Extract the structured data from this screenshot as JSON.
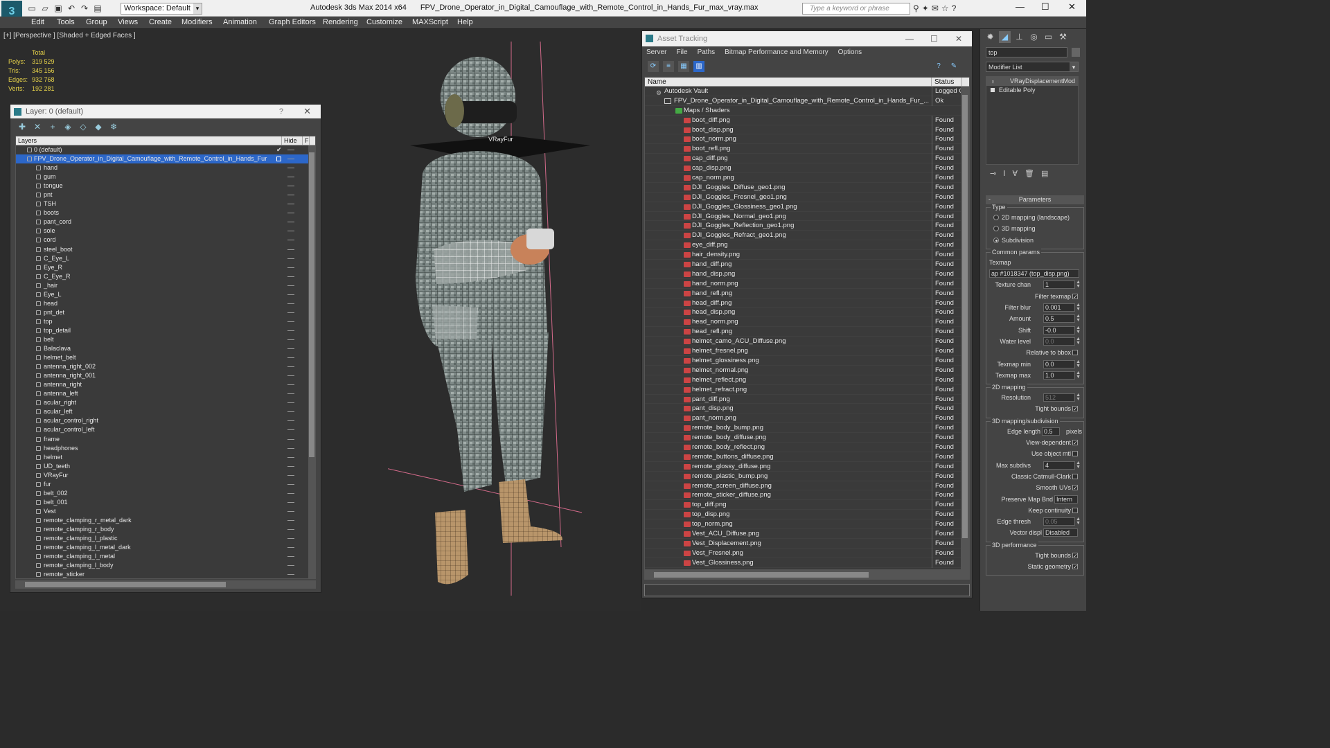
{
  "app": {
    "title": "Autodesk 3ds Max 2014 x64",
    "file": "FPV_Drone_Operator_in_Digital_Camouflage_with_Remote_Control_in_Hands_Fur_max_vray.max",
    "workspace": "Workspace: Default",
    "search_placeholder": "Type a keyword or phrase"
  },
  "menu": [
    "Edit",
    "Tools",
    "Group",
    "Views",
    "Create",
    "Modifiers",
    "Animation",
    "Graph Editors",
    "Rendering",
    "Customize",
    "MAXScript",
    "Help"
  ],
  "viewport": {
    "label": "[+] [Perspective ] [Shaded + Edged Faces ]",
    "stats_header": "Total",
    "stats": [
      {
        "label": "Polys:",
        "value": "319 529"
      },
      {
        "label": "Tris:",
        "value": "345 156"
      },
      {
        "label": "Edges:",
        "value": "932 768"
      },
      {
        "label": "Verts:",
        "value": "192 281"
      }
    ],
    "fur_label": "VRayFur"
  },
  "layer_window": {
    "title": "Layer: 0 (default)",
    "help": "?",
    "col_layers": "Layers",
    "col_hide": "Hide",
    "col_extra": "F",
    "default_layer": "0 (default)",
    "selected_layer": "FPV_Drone_Operator_in_Digital_Camouflage_with_Remote_Control_in_Hands_Fur",
    "items": [
      "hand",
      "gum",
      "tongue",
      "pnt",
      "TSH",
      "boots",
      "pant_cord",
      "sole",
      "cord",
      "steel_boot",
      "C_Eye_L",
      "Eye_R",
      "C_Eye_R",
      "_hair",
      "Eye_L",
      "head",
      "pnt_det",
      "top",
      "top_detail",
      "belt",
      "Balaclava",
      "helmet_belt",
      "antenna_right_002",
      "antenna_right_001",
      "antenna_right",
      "antenna_left",
      "acular_right",
      "acular_left",
      "acular_control_right",
      "acular_control_left",
      "frame",
      "headphones",
      "helmet",
      "UD_teeth",
      "VRayFur",
      "fur",
      "belt_002",
      "belt_001",
      "Vest",
      "remote_clamping_r_metal_dark",
      "remote_clamping_r_body",
      "remote_clamping_l_plastic",
      "remote_clamping_l_metal_dark",
      "remote_clamping_l_metal",
      "remote_clamping_l_body",
      "remote_sticker"
    ]
  },
  "asset_window": {
    "title": "Asset Tracking",
    "menu": [
      "Server",
      "File",
      "Paths",
      "Bitmap Performance and Memory",
      "Options"
    ],
    "col_name": "Name",
    "col_status": "Status",
    "vault": {
      "name": "Autodesk Vault",
      "status": "Logged O"
    },
    "file": {
      "name": "FPV_Drone_Operator_in_Digital_Camouflage_with_Remote_Control_in_Hands_Fur_...",
      "status": "Ok"
    },
    "maps_group": "Maps / Shaders",
    "found": "Found",
    "maps": [
      "boot_diff.png",
      "boot_disp.png",
      "boot_norm.png",
      "boot_refl.png",
      "cap_diff.png",
      "cap_disp.png",
      "cap_norm.png",
      "DJI_Goggles_Diffuse_geo1.png",
      "DJI_Goggles_Fresnel_geo1.png",
      "DJI_Goggles_Glossiness_geo1.png",
      "DJI_Goggles_Normal_geo1.png",
      "DJI_Goggles_Reflection_geo1.png",
      "DJI_Goggles_Refract_geo1.png",
      "eye_diff.png",
      "hair_density.png",
      "hand_diff.png",
      "hand_disp.png",
      "hand_norm.png",
      "hand_refl.png",
      "head_diff.png",
      "head_disp.png",
      "head_norm.png",
      "head_refl.png",
      "helmet_camo_ACU_Diffuse.png",
      "helmet_fresnel.png",
      "helmet_glossiness.png",
      "helmet_normal.png",
      "helmet_reflect.png",
      "helmet_refract.png",
      "pant_diff.png",
      "pant_disp.png",
      "pant_norm.png",
      "remote_body_bump.png",
      "remote_body_diffuse.png",
      "remote_body_reflect.png",
      "remote_buttons_diffuse.png",
      "remote_glossy_diffuse.png",
      "remote_plastic_bump.png",
      "remote_screen_diffuse.png",
      "remote_sticker_diffuse.png",
      "top_diff.png",
      "top_disp.png",
      "top_norm.png",
      "Vest_ACU_Diffuse.png",
      "Vest_Displacement.png",
      "Vest_Fresnel.png",
      "Vest_Glossiness.png"
    ]
  },
  "command_panel": {
    "object_name": "top",
    "modifier_list": "Modifier List",
    "stack": [
      "VRayDisplacementMod",
      "Editable Poly"
    ],
    "parameters": "Parameters",
    "type_label": "Type",
    "type_options": [
      "2D mapping (landscape)",
      "3D mapping",
      "Subdivision"
    ],
    "common_params": "Common params",
    "texmap_label": "Texmap",
    "texmap_value": "ap #1018347 (top_disp.png)",
    "texture_chan": {
      "label": "Texture chan",
      "value": "1"
    },
    "filter_texmap": "Filter texmap",
    "filter_blur": {
      "label": "Filter blur",
      "value": "0.001"
    },
    "amount": {
      "label": "Amount",
      "value": "0.5"
    },
    "shift": {
      "label": "Shift",
      "value": "-0.0"
    },
    "water_level": {
      "label": "Water level",
      "value": "0.0"
    },
    "relative_bbox": "Relative to bbox",
    "texmap_min": {
      "label": "Texmap min",
      "value": "0.0"
    },
    "texmap_max": {
      "label": "Texmap max",
      "value": "1.0"
    },
    "mapping2d": "2D mapping",
    "resolution": {
      "label": "Resolution",
      "value": "512"
    },
    "tight_bounds": "Tight bounds",
    "mapping3d": "3D mapping/subdivision",
    "edge_length": {
      "label": "Edge length",
      "value": "0.5",
      "unit": "pixels"
    },
    "view_dependent": "View-dependent",
    "use_object_mtl": "Use object mtl",
    "max_subdivs": {
      "label": "Max subdivs",
      "value": "4"
    },
    "classic_catmull": "Classic Catmull-Clark",
    "smooth_uvs": "Smooth UVs",
    "preserve_map_bnd": {
      "label": "Preserve Map Bnd",
      "value": "Intern"
    },
    "keep_continuity": "Keep continuity",
    "edge_thresh": {
      "label": "Edge thresh",
      "value": "0.05"
    },
    "vector_displ": {
      "label": "Vector displ",
      "value": "Disabled"
    },
    "perf3d": "3D performance",
    "tight_bounds2": "Tight bounds",
    "static_geometry": "Static geometry"
  }
}
